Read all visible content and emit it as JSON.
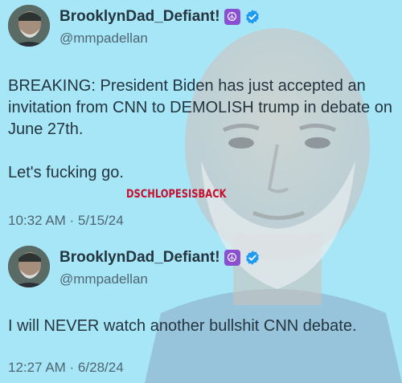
{
  "posts": [
    {
      "display_name": "BrooklynDad_Defiant!",
      "badge_emoji": "☮",
      "handle": "@mmpadellan",
      "paragraphs": [
        "BREAKING: President Biden has just accepted an invitation from CNN to DEMOLISH trump in debate on June 27th.",
        "Let's fucking go."
      ],
      "timestamp": "10:32 AM · 5/15/24"
    },
    {
      "display_name": "BrooklynDad_Defiant!",
      "badge_emoji": "☮",
      "handle": "@mmpadellan",
      "paragraphs": [
        "I will NEVER watch another bullshit CNN debate."
      ],
      "timestamp": "12:27 AM · 6/28/24"
    }
  ],
  "watermark": "DSCHLOPESISBACK",
  "colors": {
    "background": "#a6e6f6",
    "text": "#253540",
    "secondary_text": "#4f6672",
    "verified": "#1d9bf0",
    "peace_badge": "#8a4fd0",
    "watermark": "#c8102e"
  },
  "icons": {
    "verified": "verified-badge-icon",
    "peace": "peace-symbol-icon"
  }
}
